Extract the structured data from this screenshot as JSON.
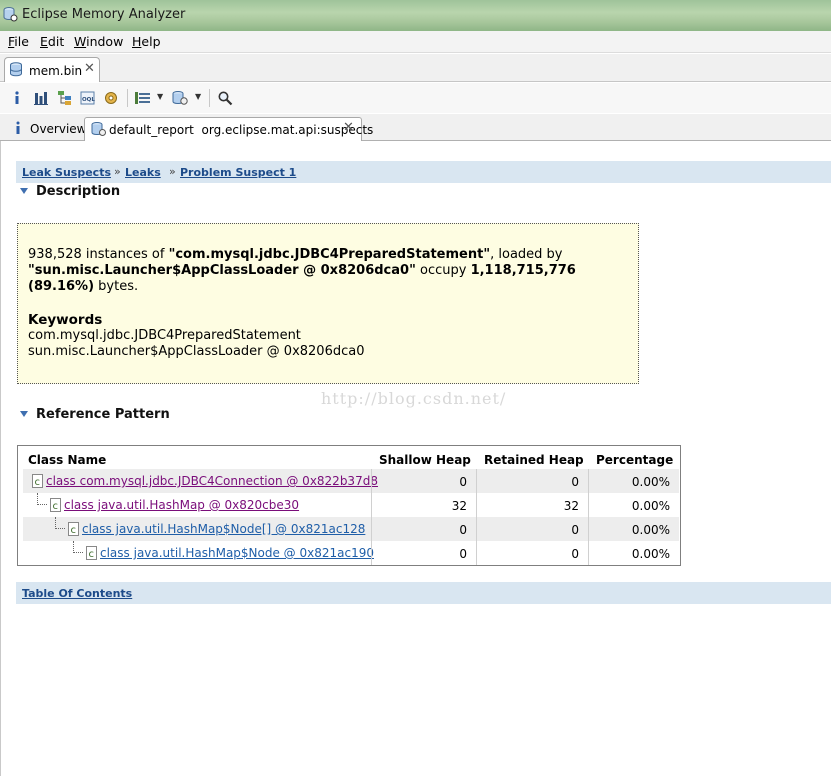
{
  "window": {
    "title": "Eclipse Memory Analyzer"
  },
  "menu": [
    "File",
    "Edit",
    "Window",
    "Help"
  ],
  "editor_tab": {
    "label": "mem.bin",
    "close": "✕"
  },
  "toolbar_icons": [
    "info-icon",
    "histogram-icon",
    "dominator-tree-icon",
    "oql-icon",
    "heap-dump-overview-icon",
    "query-browser-icon",
    "run-report-icon",
    "search-icon"
  ],
  "report_tabs": [
    {
      "label": "Overview",
      "icon": "info-icon"
    },
    {
      "label": "default_report  org.eclipse.mat.api:suspects",
      "icon": "report-icon",
      "close": "✕"
    }
  ],
  "breadcrumb": [
    {
      "label": "Leak Suspects"
    },
    {
      "label": "Leaks"
    },
    {
      "label": "Problem Suspect 1"
    }
  ],
  "breadcrumb_separator": "»",
  "description": {
    "heading": "Description",
    "count": "938,528",
    "text_instances_of": "instances of",
    "class_name": "\"com.mysql.jdbc.JDBC4PreparedStatement\"",
    "text_loaded_by": ", loaded by",
    "loader": "\"sun.misc.Launcher$AppClassLoader @ 0x8206dca0\"",
    "text_occupy": "occupy",
    "bytes_value": "1,118,715,776",
    "percent": "(89.16%)",
    "text_bytes": "bytes.",
    "keywords_title": "Keywords",
    "keywords": [
      "com.mysql.jdbc.JDBC4PreparedStatement",
      "sun.misc.Launcher$AppClassLoader @ 0x8206dca0"
    ]
  },
  "watermark": "http://blog.csdn.net/",
  "reference_pattern": {
    "heading": "Reference Pattern",
    "columns": [
      "Class Name",
      "Shallow Heap",
      "Retained Heap",
      "Percentage"
    ],
    "rows": [
      {
        "name": "class com.mysql.jdbc.JDBC4Connection @ 0x822b37d8",
        "shallow": "0",
        "retained": "0",
        "percentage": "0.00%"
      },
      {
        "name": "class java.util.HashMap @ 0x820cbe30",
        "shallow": "32",
        "retained": "32",
        "percentage": "0.00%"
      },
      {
        "name": "class java.util.HashMap$Node[] @ 0x821ac128",
        "shallow": "0",
        "retained": "0",
        "percentage": "0.00%"
      },
      {
        "name": "class java.util.HashMap$Node @ 0x821ac190",
        "shallow": "0",
        "retained": "0",
        "percentage": "0.00%"
      }
    ]
  },
  "footer_link": "Table Of Contents",
  "colors": {
    "link": "#1f5ea8",
    "visited_link": "#7a0d7a",
    "crumb_bar": "#d9e6f1",
    "description_bg": "#fefde2"
  }
}
